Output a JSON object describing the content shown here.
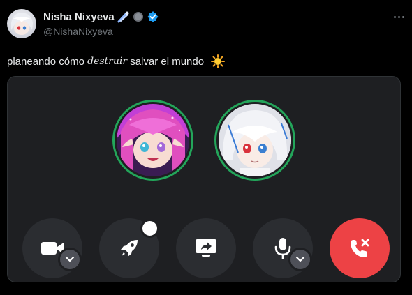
{
  "tweet": {
    "display_name": "Nisha Nixyeva",
    "handle": "@NishaNixyeva",
    "text_before": "planeando cómo ",
    "text_struck": "destruir",
    "text_after": " salvar el mundo",
    "emoji_icon": "sun-icon"
  },
  "call": {
    "participants": [
      {
        "name": "participant-pink-hair",
        "status_color": "#23a55a"
      },
      {
        "name": "participant-white-hair",
        "status_color": "#23a55a"
      }
    ],
    "controls": [
      {
        "icon": "video-camera-icon",
        "has_menu": true
      },
      {
        "icon": "rocket-icon",
        "has_indicator": true
      },
      {
        "icon": "screen-share-icon"
      },
      {
        "icon": "microphone-icon",
        "has_menu": true
      },
      {
        "icon": "end-call-icon",
        "color": "#ed4245"
      }
    ]
  }
}
